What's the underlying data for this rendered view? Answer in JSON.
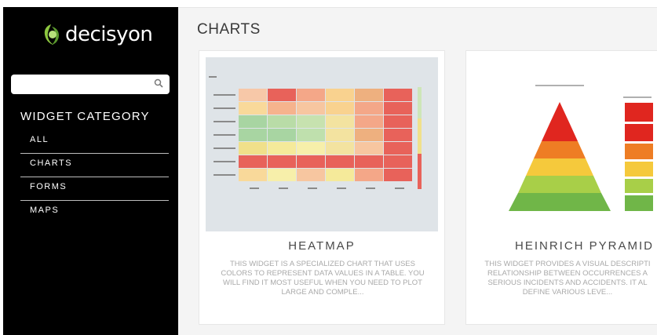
{
  "brand": {
    "name": "decisyon"
  },
  "search": {
    "value": "",
    "placeholder": ""
  },
  "sidebar": {
    "category_title": "WIDGET CATEGORY",
    "items": [
      {
        "label": "ALL"
      },
      {
        "label": "CHARTS"
      },
      {
        "label": "FORMS"
      },
      {
        "label": "MAPS"
      }
    ]
  },
  "main": {
    "title": "CHARTS",
    "cards": [
      {
        "title": "HEATMAP",
        "description_lines": [
          "THIS WIDGET IS A SPECIALIZED CHART THAT USES",
          "COLORS TO REPRESENT DATA VALUES IN A TABLE. YOU",
          "WILL FIND IT MOST USEFUL WHEN YOU NEED TO PLOT",
          "LARGE AND COMPLE..."
        ]
      },
      {
        "title": "HEINRICH PYRAMID",
        "description_lines": [
          "THIS WIDGET PROVIDES A VISUAL DESCRIPTI",
          "RELATIONSHIP BETWEEN OCCURRENCES A",
          "SERIOUS INCIDENTS AND ACCIDENTS. IT AL",
          "DEFINE VARIOUS LEVE..."
        ]
      }
    ]
  },
  "colors": {
    "sidebar_bg": "#000000",
    "logo_green": "#8cc63f",
    "main_bg": "#f4f4f4",
    "heat_red": "#e8625a",
    "heat_green": "#a8d5a2",
    "pyramid_red": "#e0261f",
    "pyramid_orange": "#ee7d24",
    "pyramid_yellow": "#f5c93c",
    "pyramid_green": "#70b648"
  },
  "icons": {
    "brand": "logo-icon",
    "search": "search-icon"
  }
}
